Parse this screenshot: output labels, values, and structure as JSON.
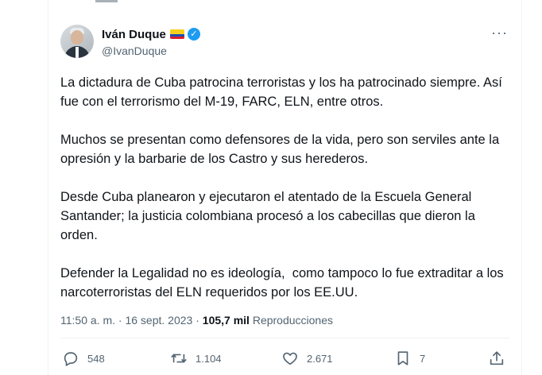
{
  "author": {
    "name": "Iván Duque",
    "handle": "@IvanDuque",
    "flag_icon": "colombia-flag-icon",
    "verified_icon": "verified-badge-icon"
  },
  "tweet": {
    "paragraphs": [
      "La dictadura de Cuba patrocina terroristas y los ha patrocinado siempre. Así fue con el terrorismo del M-19, FARC, ELN, entre otros.",
      "Muchos se presentan como defensores de la vida, pero son serviles ante la opresión y la barbarie de los Castro y sus herederos.",
      "Desde Cuba planearon y ejecutaron el atentado de la Escuela General Santander; la justicia colombiana procesó a los cabecillas que dieron la orden.",
      "Defender la Legalidad no es ideología,  como tampoco lo fue extraditar a los narcoterroristas del ELN requeridos por los EE.UU."
    ],
    "time": "11:50 a. m.",
    "separator": "·",
    "date": "16 sept. 2023",
    "views_count": "105,7 mil",
    "views_label": "Reproducciones"
  },
  "actions": {
    "replies": "548",
    "retweets": "1.104",
    "likes": "2.671",
    "bookmarks": "7"
  },
  "colors": {
    "accent": "#1d9bf0",
    "text": "#0f1419",
    "muted": "#536471",
    "border": "#eff3f4"
  }
}
